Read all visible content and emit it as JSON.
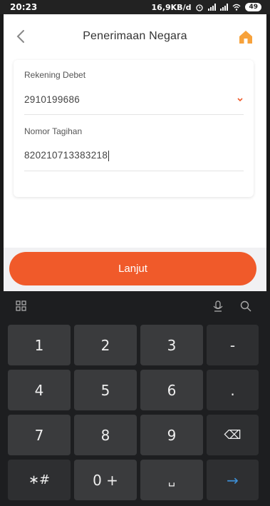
{
  "status_bar": {
    "time": "20:23",
    "network_speed": "16,9KB/d",
    "battery": "49"
  },
  "header": {
    "title": "Penerimaan Negara",
    "back_icon": "chevron-left-icon",
    "home_icon": "home-icon"
  },
  "form": {
    "rekening_label": "Rekening Debet",
    "rekening_value": "2910199686",
    "tagihan_label": "Nomor Tagihan",
    "tagihan_value": "820210713383218"
  },
  "actions": {
    "lanjut_label": "Lanjut"
  },
  "keyboard": {
    "rows": [
      [
        "1",
        "2",
        "3",
        "-"
      ],
      [
        "4",
        "5",
        "6",
        "."
      ],
      [
        "7",
        "8",
        "9",
        "⌫"
      ],
      [
        "∗#",
        "0 +",
        "␣",
        "→"
      ]
    ]
  },
  "colors": {
    "accent": "#f05a2a",
    "home_icon": "#f7a23b"
  }
}
